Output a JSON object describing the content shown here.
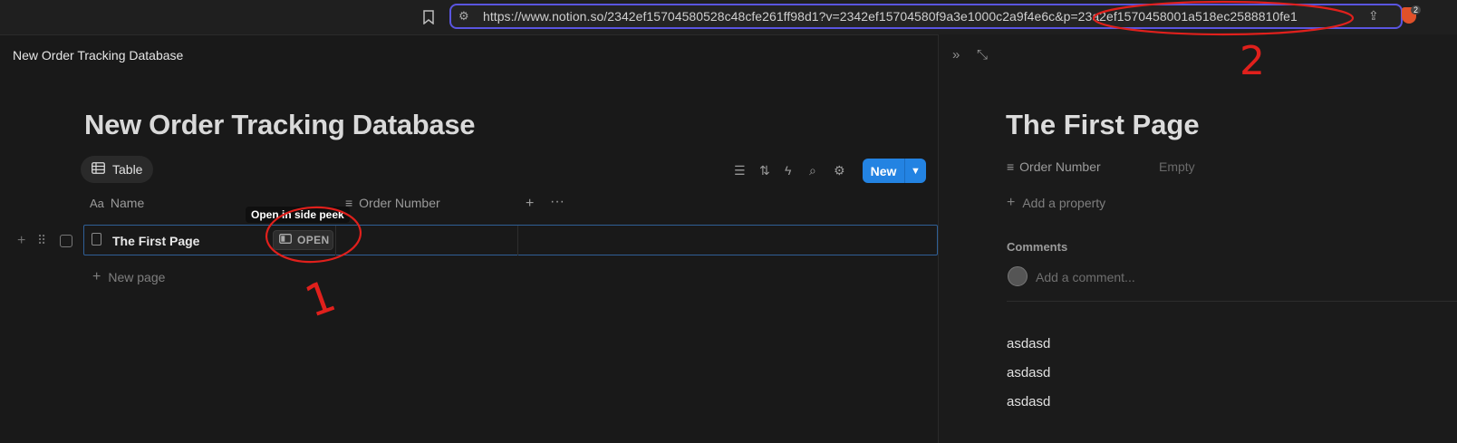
{
  "browser": {
    "url": "https://www.notion.so/2342ef15704580528c48cfe261ff98d1?v=2342ef15704580f9a3e1000c2a9f4e6c&p=23a2ef1570458001a518ec2588810fe1",
    "brave_badge": "2",
    "icons": [
      "bookmark-icon",
      "site-settings-icon",
      "share-icon",
      "brave-shield-icon"
    ]
  },
  "page": {
    "breadcrumb": "New Order Tracking Database",
    "title": "New Order Tracking Database"
  },
  "view": {
    "tab_label": "Table",
    "new_button": "New"
  },
  "table": {
    "columns": [
      {
        "label": "Name",
        "icon": "text-type-icon"
      },
      {
        "label": "Order Number",
        "icon": "lines-icon"
      }
    ],
    "rows": [
      {
        "name": "The First Page",
        "order_number": ""
      }
    ],
    "open_button": "OPEN",
    "tooltip": "Open in side peek",
    "new_page": "New page"
  },
  "peek": {
    "title": "The First Page",
    "properties": [
      {
        "label": "Order Number",
        "value": "Empty"
      }
    ],
    "add_property": "Add a property",
    "comments_heading": "Comments",
    "comment_placeholder": "Add a comment...",
    "content": [
      "asdasd",
      "asdasd",
      "asdasd"
    ]
  },
  "annotations": {
    "label_1": "1",
    "label_2": "2",
    "color": "#e0201c"
  }
}
